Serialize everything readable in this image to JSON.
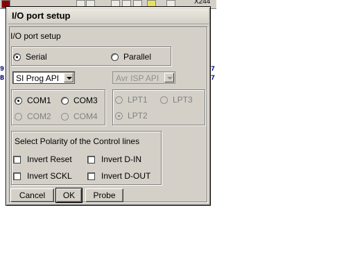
{
  "background_app": {
    "coordinate_readout": "X244"
  },
  "dialog": {
    "title": "I/O port setup",
    "panel_caption": "I/O port setup",
    "interface": {
      "serial_label": "Serial",
      "serial_selected": true,
      "parallel_label": "Parallel",
      "parallel_selected": false
    },
    "serial_api_select": {
      "value": "SI Prog API"
    },
    "parallel_api_select": {
      "value": "Avr ISP API",
      "disabled": true
    },
    "com_ports": [
      {
        "label": "COM1",
        "checked": true,
        "disabled": false
      },
      {
        "label": "COM3",
        "checked": false,
        "disabled": false
      },
      {
        "label": "COM2",
        "checked": false,
        "disabled": true
      },
      {
        "label": "COM4",
        "checked": false,
        "disabled": true
      }
    ],
    "lpt_ports": [
      {
        "label": "LPT1",
        "checked": false,
        "disabled": true
      },
      {
        "label": "LPT3",
        "checked": false,
        "disabled": true
      },
      {
        "label": "LPT2",
        "checked": true,
        "disabled": true
      }
    ],
    "polarity": {
      "title": "Select Polarity of the Control lines",
      "options": [
        {
          "label": "Invert Reset",
          "checked": false
        },
        {
          "label": "Invert D-IN",
          "checked": false
        },
        {
          "label": "Invert SCKL",
          "checked": false
        },
        {
          "label": "Invert D-OUT",
          "checked": false
        }
      ]
    },
    "buttons": {
      "cancel": "Cancel",
      "ok": "OK",
      "probe": "Probe"
    }
  }
}
